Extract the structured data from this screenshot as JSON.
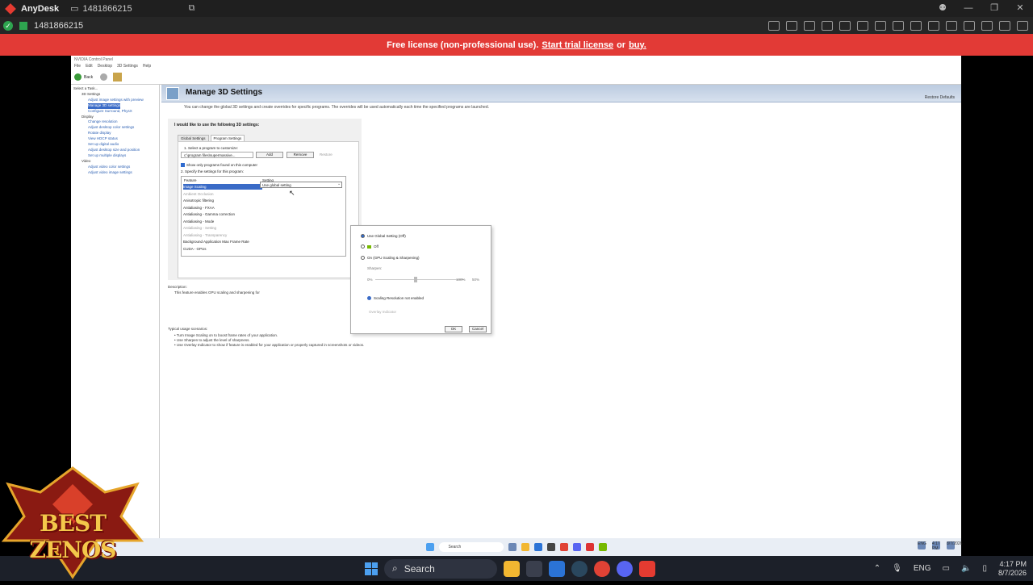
{
  "anydesk": {
    "app_name": "AnyDesk",
    "tab_id": "1481866215",
    "session_id": "1481866215",
    "banner": {
      "prefix": "Free license (non-professional use).",
      "trial_link": "Start trial license",
      "or": "or",
      "buy_link": "buy."
    },
    "colors": {
      "banner": "#e23a36",
      "accent": "#e43b31",
      "ok": "#2ea44f"
    }
  },
  "nvidia": {
    "window_title": "NVIDIA Control Panel",
    "menu": [
      "File",
      "Edit",
      "Desktop",
      "3D Settings",
      "Help"
    ],
    "toolbar": {
      "back": "Back"
    },
    "tree": {
      "select_task": "Select a Task...",
      "cat_3d": "3D Settings",
      "adjust_preview": "Adjust image settings with preview",
      "manage_3d": "Manage 3D settings",
      "configure_surround": "Configure Surround, PhysX",
      "cat_display": "Display",
      "change_resolution": "Change resolution",
      "adjust_color": "Adjust desktop color settings",
      "rotate": "Rotate display",
      "hdcp": "View HDCP status",
      "digital_audio": "Set up digital audio",
      "desktop_size": "Adjust desktop size and position",
      "multiple_displays": "Set up multiple displays",
      "cat_video": "Video",
      "video_color": "Adjust video color settings",
      "video_image": "Adjust video image settings"
    },
    "page": {
      "title": "Manage 3D Settings",
      "restore_defaults": "Restore Defaults",
      "intro": "You can change the global 3D settings and create overrides for specific programs. The overrides will be used automatically each time the specified programs are launched.",
      "question": "I would like to use the following 3D settings:",
      "tab_global": "Global Settings",
      "tab_program": "Program Settings",
      "step1": "1. Select a program to customize:",
      "program_value": "c:\\program files\\supermassive...",
      "add": "Add",
      "remove": "Remove",
      "restore": "Restore",
      "show_only": "Show only programs found on this computer",
      "step2": "2. Specify the settings for this program:",
      "col_feature": "Feature",
      "col_setting": "Setting",
      "features": [
        "Image Scaling",
        "Ambient Occlusion",
        "Anisotropic filtering",
        "Antialiasing - FXAA",
        "Antialiasing - Gamma correction",
        "Antialiasing - Mode",
        "Antialiasing - Setting",
        "Antialiasing - Transparency",
        "Background Application Max Frame Rate",
        "CUDA - GPUs"
      ],
      "setting_value": "Use global setting",
      "description_label": "Description:",
      "description_text": "This feature enables GPU scaling and sharpening for",
      "usage_label": "Typical usage scenarios:",
      "usage": [
        "• Turn Image Scaling on to boost frame rates of your application.",
        "• Use Sharpen to adjust the level of sharpness.",
        "• Use Overlay Indicator to show if feature is enabled for your application or properly captured in screenshots or videos."
      ]
    },
    "popup": {
      "opt_global": "Use Global Setting (Off)",
      "opt_off": "Off",
      "opt_on": "On (GPU Scaling & Sharpening)",
      "sharpen": "Sharpen:",
      "min": "0%",
      "max": "100%",
      "value": "50%",
      "info": "Scaling Resolution not enabled",
      "overlay": "Overlay Indicator",
      "ok": "OK",
      "cancel": "Cancel"
    }
  },
  "remote_taskbar": {
    "search": "Search",
    "lang": "ENG",
    "time": "4:17 PM",
    "date": "8/7/2026"
  },
  "taskbar": {
    "search": "Search",
    "lang": "ENG",
    "time": "4:17 PM",
    "date": "8/7/2026"
  },
  "watermark": "BEST ZENOS"
}
